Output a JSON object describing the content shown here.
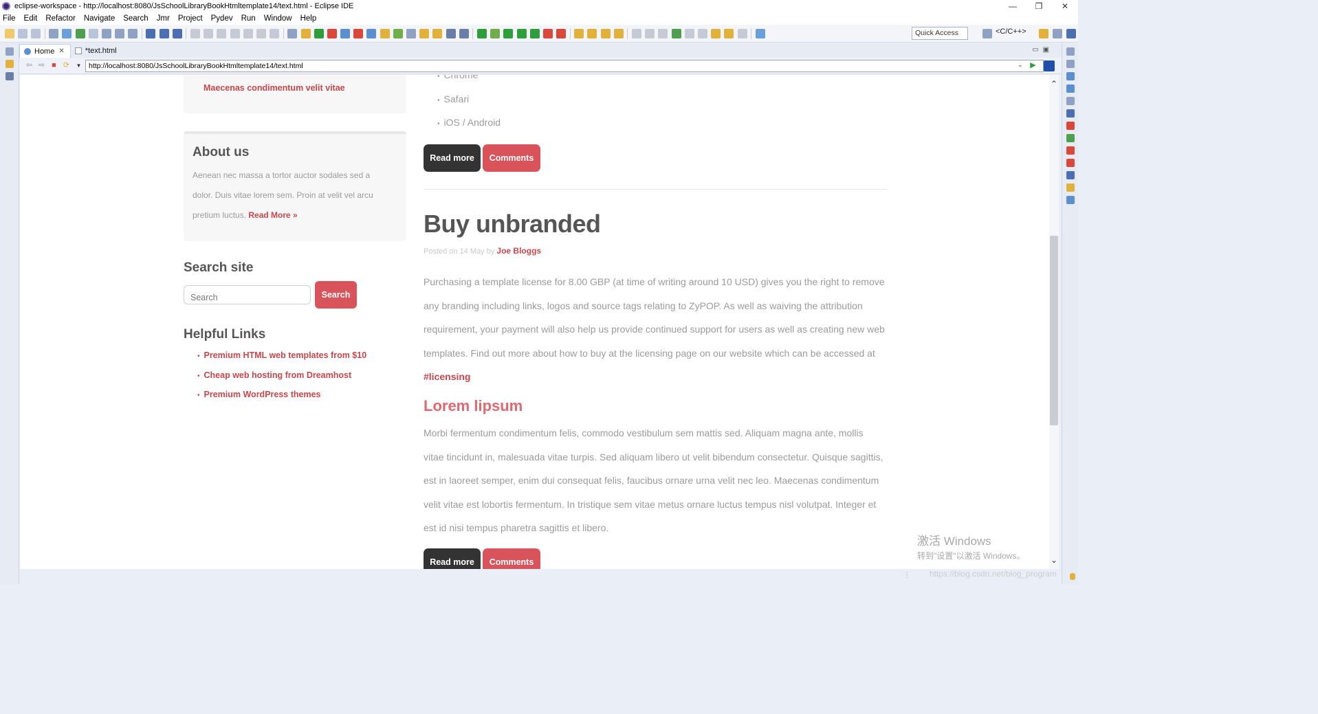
{
  "window": {
    "title": "eclipse-workspace - http://localhost:8080/JsSchoolLibraryBookHtmltemplate14/text.html - Eclipse IDE",
    "controls": [
      "—",
      "❐",
      "✕"
    ]
  },
  "menu": [
    "File",
    "Edit",
    "Refactor",
    "Navigate",
    "Search",
    "Jmr",
    "Project",
    "Pydev",
    "Run",
    "Window",
    "Help"
  ],
  "toolbar": {
    "quick_access_label": "Quick Access",
    "perspective_label": "<C/C++>"
  },
  "tabs": [
    {
      "label": "Home",
      "close": "✕"
    },
    {
      "label": "*text.html"
    }
  ],
  "browser": {
    "url": "http://localhost:8080/JsSchoolLibraryBookHtmltemplate14/text.html"
  },
  "sidebar": {
    "top_link": "Maecenas condimentum velit vitae",
    "about": {
      "title": "About us",
      "text": "Aenean nec massa a tortor auctor sodales sed a dolor. Duis vitae lorem sem. Proin at velit vel arcu pretium luctus.",
      "read_more": "Read More »"
    },
    "search": {
      "title": "Search site",
      "placeholder": "Search",
      "button": "Search"
    },
    "helpful_links": {
      "title": "Helpful Links",
      "items": [
        "Premium HTML web templates from $10",
        "Cheap web hosting from Dreamhost",
        "Premium WordPress themes"
      ]
    }
  },
  "main": {
    "list": [
      "Chrome",
      "Safari",
      "iOS / Android"
    ],
    "read_more": "Read more",
    "comments": "Comments",
    "post": {
      "title": "Buy unbranded",
      "posted_on": "Posted on 14 May by",
      "author": "Joe Bloggs",
      "body": "Purchasing a template license for 8.00 GBP (at time of writing around 10 USD) gives you the right to remove any branding including links, logos and source tags relating to ZyPOP. As well as waiving the attribution requirement, your payment will also help us provide continued support for users as well as creating new web templates. Find out more about how to buy at the licensing page on our website which can be accessed at",
      "link": "#licensing",
      "subtitle": "Lorem lipsum",
      "subtitle_body": "Morbi fermentum condimentum felis, commodo vestibulum sem mattis sed. Aliquam magna ante, mollis vitae tincidunt in, malesuada vitae turpis. Sed aliquam libero ut velit bibendum consectetur. Quisque sagittis, est in laoreet semper, enim dui consequat felis, faucibus ornare urna velit nec leo. Maecenas condimentum velit vitae est lobortis fermentum. In tristique sem vitae metus ornare luctus tempus nisl volutpat. Integer et est id nisi tempus pharetra sagittis et libero."
    }
  },
  "watermark": {
    "line1": "激活 Windows",
    "line2": "转到\"设置\"以激活 Windows。"
  },
  "csdn_watermark": "https://blog.csdn.net/blog_program",
  "colors": {
    "accent_red": "#d9535a",
    "dark_button": "#333333",
    "subtitle_pink": "#e06970"
  }
}
